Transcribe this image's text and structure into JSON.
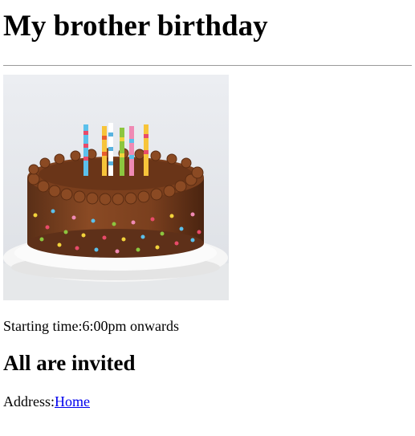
{
  "heading": "My brother birthday",
  "image": {
    "subject": "birthday-cake-photo"
  },
  "starting_time": "Starting time:6:00pm onwards",
  "subheading": "All are invited",
  "address": {
    "label": "Address:",
    "link_text": "Home"
  },
  "colors": {
    "link": "#0000ee",
    "rule": "#9a9a9a"
  }
}
